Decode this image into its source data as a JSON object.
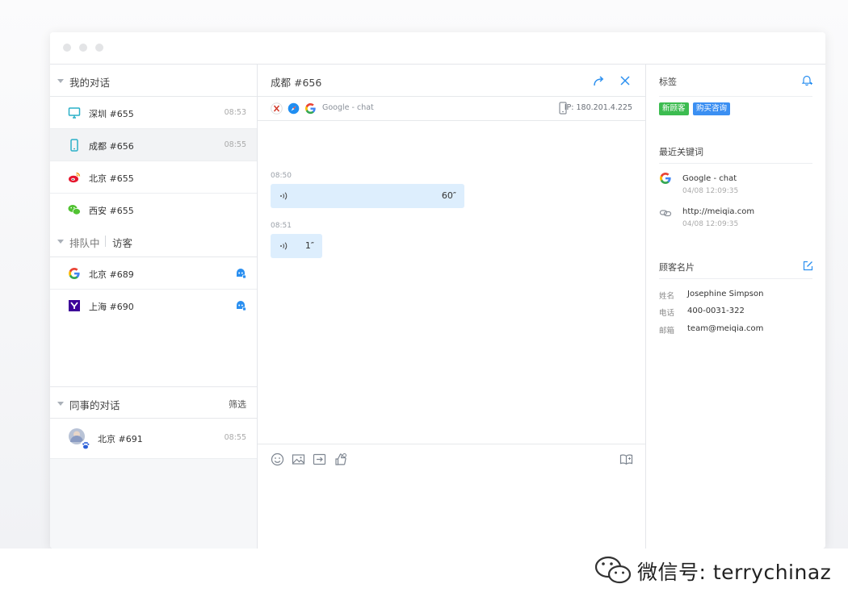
{
  "colors": {
    "accent": "#2a8ff0",
    "green_tag": "#3cbc50",
    "blue_tag": "#3b8ff2",
    "voice_bubble": "#ddeefd"
  },
  "sidebar": {
    "my_conversations": {
      "title": "我的对话",
      "items": [
        {
          "name": "深圳 #655",
          "time": "08:53",
          "icon": "desktop-icon"
        },
        {
          "name": "成都 #656",
          "time": "08:55",
          "icon": "mobile-icon"
        },
        {
          "name": "北京 #655",
          "icon": "weibo-icon"
        },
        {
          "name": "西安 #655",
          "icon": "wechat-icon"
        }
      ]
    },
    "queue": {
      "title": "排队中",
      "tab_visitors": "访客",
      "items": [
        {
          "name": "北京 #689",
          "icon": "google-icon"
        },
        {
          "name": "上海 #690",
          "icon": "yahoo-icon"
        }
      ]
    },
    "colleagues": {
      "title": "同事的对话",
      "filter_label": "筛选",
      "items": [
        {
          "name": "北京 #691",
          "time": "08:55",
          "icon": "avatar"
        }
      ]
    }
  },
  "chat": {
    "title": "成都 #656",
    "source_text": "Google - chat",
    "ip_text": "IP: 180.201.4.225",
    "messages": [
      {
        "time": "08:50",
        "duration": "60″"
      },
      {
        "time": "08:51",
        "duration": "1″"
      }
    ]
  },
  "details": {
    "tags_title": "标签",
    "tags": [
      "新顾客",
      "购买咨询"
    ],
    "keywords_title": "最近关键词",
    "keywords": [
      {
        "text": "Google - chat",
        "time": "04/08 12:09:35",
        "icon": "google-icon"
      },
      {
        "text": "http://meiqia.com",
        "time": "04/08 12:09:35",
        "icon": "link-icon"
      }
    ],
    "card_title": "顾客名片",
    "fields": [
      {
        "label": "姓名",
        "value": "Josephine Simpson"
      },
      {
        "label": "电话",
        "value": "400-0031-322"
      },
      {
        "label": "邮箱",
        "value": "team@meiqia.com"
      }
    ]
  },
  "watermark": {
    "text": "微信号: terrychinaz"
  }
}
